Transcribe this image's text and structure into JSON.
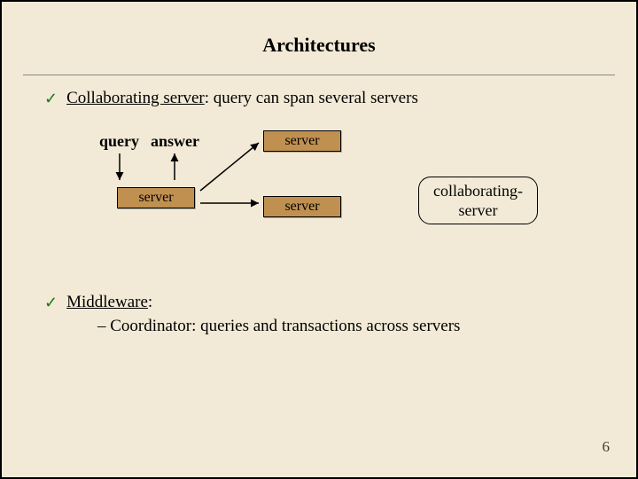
{
  "title": "Architectures",
  "bullets": {
    "b1_prefix": "Collaborating server",
    "b1_suffix": ": query can span several servers",
    "b2_prefix": "Middleware",
    "b2_suffix": ":",
    "sub": "– Coordinator: queries and transactions across servers"
  },
  "diagram": {
    "query": "query",
    "answer": "answer",
    "server": "server",
    "collab_l1": "collaborating-",
    "collab_l2": "server"
  },
  "page_number": "6"
}
